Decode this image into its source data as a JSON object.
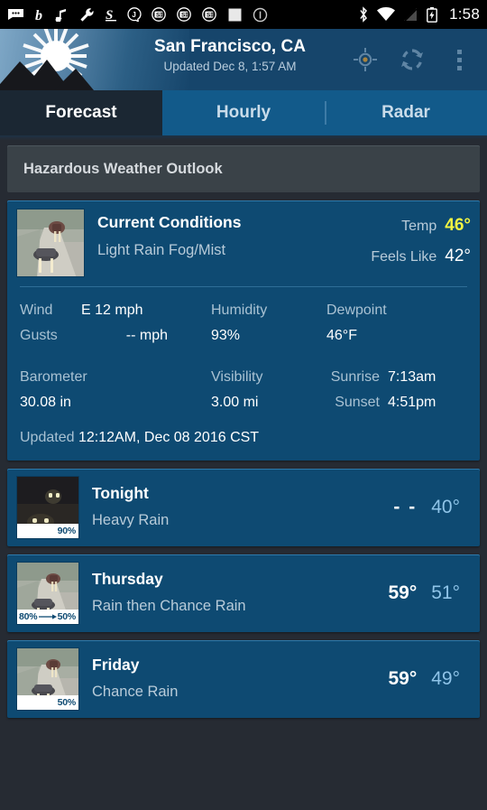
{
  "statusbar": {
    "time": "1:58",
    "left_icons": [
      "messages-icon",
      "b-app-icon",
      "music-note-icon",
      "wrench-icon",
      "s-app-icon",
      "j-chat-icon",
      "s-card-icon",
      "s-card-icon",
      "s-card-icon",
      "square-app-icon",
      "info-circle-icon"
    ],
    "right_icons": [
      "bluetooth-icon",
      "wifi-icon",
      "signal-icon",
      "battery-charging-icon"
    ]
  },
  "header": {
    "title": "San Francisco, CA",
    "subtitle": "Updated Dec 8, 1:57 AM",
    "logo": "sun-mountain-logo",
    "actions": [
      {
        "name": "my-location-icon",
        "label": "My Location"
      },
      {
        "name": "refresh-icon",
        "label": "Refresh"
      },
      {
        "name": "overflow-menu-icon",
        "label": "More options"
      }
    ]
  },
  "tabs": [
    {
      "label": "Forecast",
      "active": true
    },
    {
      "label": "Hourly",
      "active": false
    },
    {
      "label": "Radar",
      "active": false
    }
  ],
  "hazard": {
    "label": "Hazardous Weather Outlook"
  },
  "current": {
    "title": "Current Conditions",
    "description": "Light Rain Fog/Mist",
    "temp_label": "Temp",
    "temp_value": "46°",
    "feels_label": "Feels Like",
    "feels_value": "42°",
    "thumb": "rainy-road-photo",
    "details": {
      "wind_label": "Wind",
      "wind_value": "E 12 mph",
      "gusts_label": "Gusts",
      "gusts_value": "-- mph",
      "humidity_label": "Humidity",
      "humidity_value": "93%",
      "dewpoint_label": "Dewpoint",
      "dewpoint_value": "46°F",
      "barometer_label": "Barometer",
      "barometer_value": "30.08 in",
      "visibility_label": "Visibility",
      "visibility_value": "3.00 mi",
      "sunrise_label": "Sunrise",
      "sunrise_value": "7:13am",
      "sunset_label": "Sunset",
      "sunset_value": "4:51pm"
    },
    "updated_label": "Updated",
    "updated_value": "12:12AM, Dec 08 2016 CST"
  },
  "forecast": [
    {
      "day": "Tonight",
      "description": "Heavy Rain",
      "high": "- -",
      "low": "40°",
      "precip": "90%",
      "precip_end": "",
      "thumb": "night-rain-road-photo"
    },
    {
      "day": "Thursday",
      "description": "Rain then Chance Rain",
      "high": "59°",
      "low": "51°",
      "precip": "80%",
      "precip_end": "50%",
      "thumb": "rainy-road-photo"
    },
    {
      "day": "Friday",
      "description": "Chance Rain",
      "high": "59°",
      "low": "49°",
      "precip": "50%",
      "precip_end": "",
      "thumb": "rainy-road-photo"
    }
  ],
  "colors": {
    "page_bg": "#262b33",
    "card_bg": "#0e4a72",
    "header_bg": "#16456b",
    "tab_bg": "#125a8a",
    "tab_active_bg": "#1b2733",
    "hazard_bg": "#3a4248",
    "temp_accent": "#f2f542",
    "low_temp": "#8fc4e8"
  }
}
